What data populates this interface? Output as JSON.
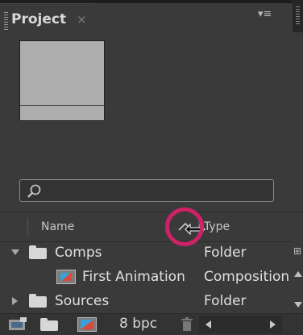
{
  "panel": {
    "tab_label": "Project",
    "tab_close": "×",
    "menu_icon": "panel-menu-icon",
    "menu_glyph": "▾≡"
  },
  "search": {
    "placeholder": "",
    "value": "",
    "icon": "search-icon"
  },
  "columns": {
    "name": "Name",
    "type": "Type",
    "sort_icon": "sort-ascending-icon"
  },
  "rows": [
    {
      "label": "Comps",
      "type": "Folder",
      "kind": "folder",
      "expanded": true,
      "indent": 0
    },
    {
      "label": "First Animation",
      "type": "Composition",
      "kind": "composition",
      "expanded": false,
      "indent": 1
    },
    {
      "label": "Sources",
      "type": "Folder",
      "kind": "folder",
      "expanded": false,
      "indent": 0
    }
  ],
  "bottom_bar": {
    "bit_depth": "8 bpc"
  },
  "colors": {
    "highlight_ring": "#cc2266",
    "panel_bg": "#3a3a3a",
    "text": "#e0e0e0"
  }
}
